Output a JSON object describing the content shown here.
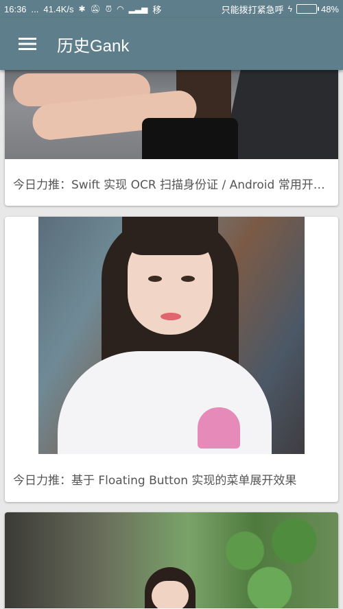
{
  "status_bar": {
    "time": "16:36",
    "dots": "...",
    "speed": "41.4K/s",
    "carrier": "移",
    "emergency": "只能拨打紧急呼",
    "battery": "48%",
    "battery_level": 0.48,
    "icons": [
      "bluetooth-icon",
      "mute-icon",
      "alarm-icon",
      "wifi-icon",
      "signal-icon",
      "charging-icon",
      "battery-icon"
    ]
  },
  "appbar": {
    "title": "历史Gank",
    "background": "#5f7e8b",
    "icon": "hamburger-menu-icon"
  },
  "cards": [
    {
      "title": "今日力推：Swift 实现 OCR 扫描身份证 / Android 常用开源库"
    },
    {
      "title": "今日力推：基于 Floating Button 实现的菜单展开效果"
    },
    {
      "title": ""
    }
  ]
}
